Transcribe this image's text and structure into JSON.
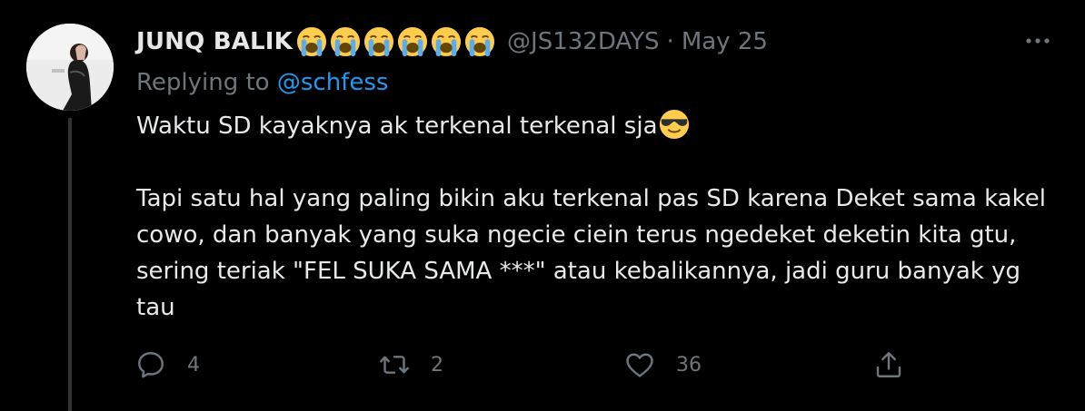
{
  "author": {
    "display_name": "JUNQ BALIK",
    "name_emojis": [
      "loudly-crying-face-icon",
      "loudly-crying-face-icon",
      "loudly-crying-face-icon",
      "loudly-crying-face-icon",
      "loudly-crying-face-icon",
      "loudly-crying-face-icon"
    ],
    "handle": "@JS132DAYS",
    "separator": "·",
    "date": "May 25"
  },
  "replying": {
    "prefix": "Replying to",
    "mention": "@schfess"
  },
  "tweet": {
    "line1": "Waktu SD kayaknya ak terkenal terkenal sja",
    "line1_emoji": "smiling-face-with-sunglasses-icon",
    "paragraph2": "Tapi satu hal yang paling bikin aku terkenal pas SD karena Deket sama kakel cowo, dan banyak yang suka ngecie ciein terus ngedeket deketin kita gtu, sering teriak \"FEL SUKA SAMA ***\" atau kebalikannya, jadi guru banyak yg tau"
  },
  "actions": {
    "reply_count": "4",
    "retweet_count": "2",
    "like_count": "36"
  },
  "colors": {
    "background": "#000000",
    "muted": "#6e767d",
    "link": "#1d9bf0",
    "text": "#e7e9ea"
  }
}
